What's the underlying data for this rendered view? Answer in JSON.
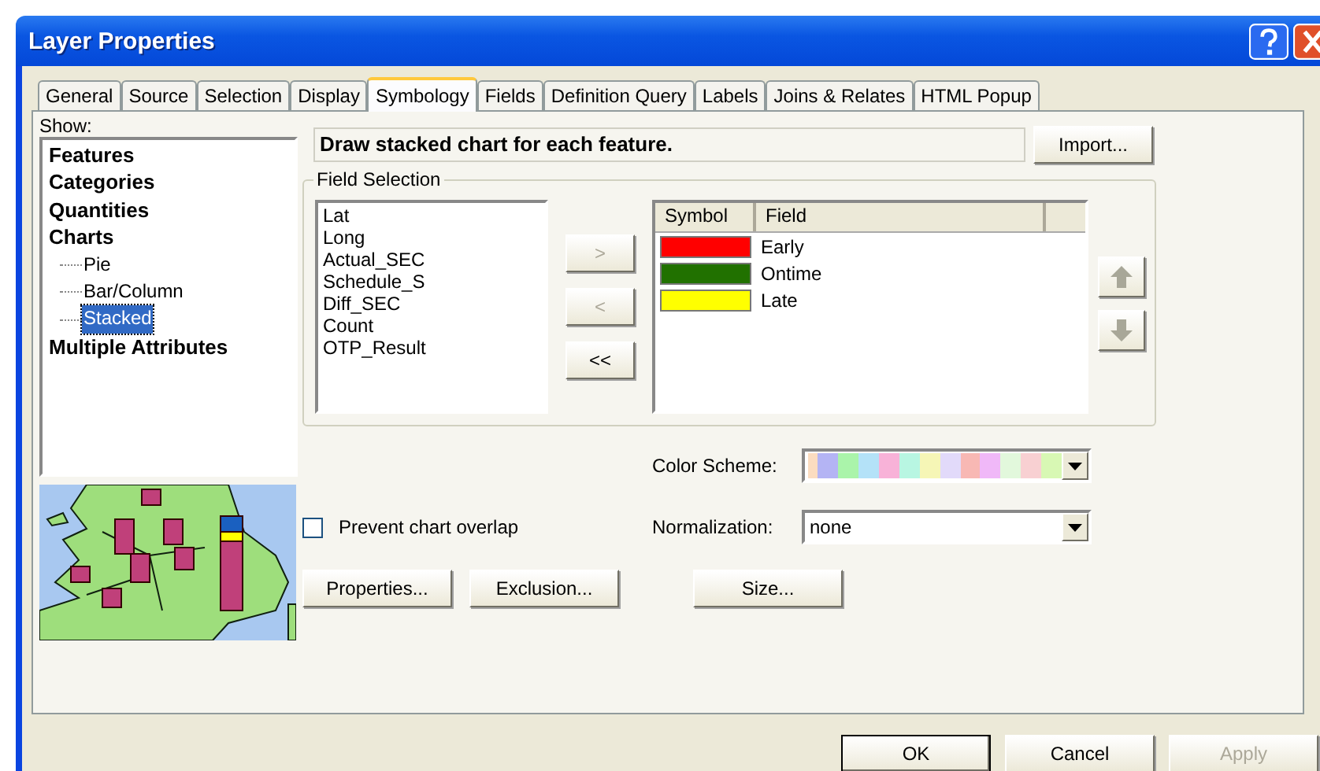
{
  "window": {
    "title": "Layer Properties"
  },
  "tabs": [
    {
      "label": "General",
      "selected": false
    },
    {
      "label": "Source",
      "selected": false
    },
    {
      "label": "Selection",
      "selected": false
    },
    {
      "label": "Display",
      "selected": false
    },
    {
      "label": "Symbology",
      "selected": true
    },
    {
      "label": "Fields",
      "selected": false
    },
    {
      "label": "Definition Query",
      "selected": false
    },
    {
      "label": "Labels",
      "selected": false
    },
    {
      "label": "Joins & Relates",
      "selected": false
    },
    {
      "label": "HTML Popup",
      "selected": false
    }
  ],
  "show": {
    "label": "Show:",
    "items": [
      {
        "label": "Features",
        "selected": false
      },
      {
        "label": "Categories",
        "selected": false
      },
      {
        "label": "Quantities",
        "selected": false
      },
      {
        "label": "Charts",
        "selected": false,
        "children": [
          {
            "label": "Pie",
            "selected": false
          },
          {
            "label": "Bar/Column",
            "selected": false
          },
          {
            "label": "Stacked",
            "selected": true
          }
        ]
      },
      {
        "label": "Multiple Attributes",
        "selected": false
      }
    ]
  },
  "description": "Draw stacked chart for each feature.",
  "import_button": "Import...",
  "field_selection": {
    "title": "Field Selection",
    "fields": [
      "Lat",
      "Long",
      "Actual_SEC",
      "Schedule_S",
      "Diff_SEC",
      "Count",
      "OTP_Result"
    ],
    "move_buttons": [
      {
        "label": ">",
        "disabled": true
      },
      {
        "label": "<",
        "disabled": true
      },
      {
        "label": "<<",
        "disabled": false
      }
    ],
    "columns": [
      "Symbol",
      "Field"
    ],
    "rows": [
      {
        "color": "#ff0000",
        "field": "Early"
      },
      {
        "color": "#217100",
        "field": "Ontime"
      },
      {
        "color": "#ffff00",
        "field": "Late"
      }
    ],
    "order_buttons": [
      {
        "kind": "up",
        "disabled": true
      },
      {
        "kind": "down",
        "disabled": true
      }
    ]
  },
  "color_scheme": {
    "label": "Color Scheme:",
    "swatches": [
      {
        "color": "#fbdcc0"
      },
      {
        "color": "#b4b4f4"
      },
      {
        "color": "#aaf4aa"
      },
      {
        "color": "#b4e2f8"
      },
      {
        "color": "#f8b2d8"
      },
      {
        "color": "#b8f6e2"
      },
      {
        "color": "#f6f6b6"
      },
      {
        "color": "#e2dafa"
      },
      {
        "color": "#f8b8b4"
      },
      {
        "color": "#f0b8f8"
      },
      {
        "color": "#e2f8dc"
      },
      {
        "color": "#f8d0d2"
      },
      {
        "color": "#d8f8b4"
      }
    ]
  },
  "normalization": {
    "label": "Normalization:",
    "value": "none"
  },
  "prevent_overlap": {
    "label": "Prevent chart overlap",
    "checked": false
  },
  "buttons": [
    {
      "label": "Properties..."
    },
    {
      "label": "Exclusion..."
    },
    {
      "label": "Size..."
    }
  ],
  "footer": [
    {
      "label": "OK",
      "default": true,
      "disabled": false
    },
    {
      "label": "Cancel",
      "default": false,
      "disabled": false
    },
    {
      "label": "Apply",
      "default": false,
      "disabled": true
    }
  ]
}
